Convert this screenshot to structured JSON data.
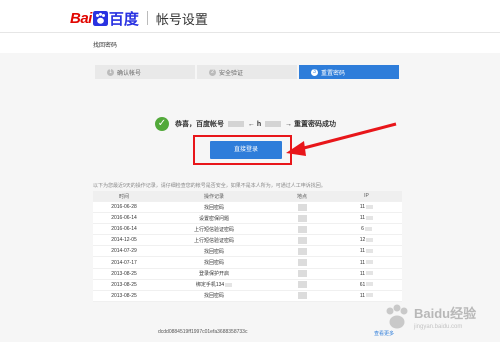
{
  "header": {
    "logo_bai": "Bai",
    "logo_du": "百度",
    "title": "帐号设置"
  },
  "subheader": {
    "title": "找回密码"
  },
  "steps": [
    {
      "num": "1",
      "label": "确认帐号",
      "active": false
    },
    {
      "num": "2",
      "label": "安全验证",
      "active": false
    },
    {
      "num": "3",
      "label": "重置密码",
      "active": true
    }
  ],
  "success": {
    "prefix": "恭喜，百度帐号",
    "arrow_text": "← h",
    "suffix": "→ 重置密码成功"
  },
  "login_button": "直接登录",
  "notice": "以下为您最近9天的操作记录，请仔细检查您的帐号是否安全，如果不是本人所为，可通过人工申诉找回。",
  "table": {
    "headers": [
      "时间",
      "操作记录",
      "地点",
      "IP"
    ],
    "rows": [
      {
        "date": "2016-06-28",
        "op": "找回密码",
        "ip": "11"
      },
      {
        "date": "2016-06-14",
        "op": "设置密保问题",
        "ip": "11"
      },
      {
        "date": "2016-06-14",
        "op": "上行短信验证密码",
        "ip": "6"
      },
      {
        "date": "2014-12-05",
        "op": "上行短信验证密码",
        "ip": "12"
      },
      {
        "date": "2014-07-29",
        "op": "找回密码",
        "ip": "11"
      },
      {
        "date": "2014-07-17",
        "op": "找回密码",
        "ip": "11"
      },
      {
        "date": "2013-08-25",
        "op": "登录保护开启",
        "ip": "11"
      },
      {
        "date": "2013-08-25",
        "op": "绑定手机134",
        "ip": "61"
      },
      {
        "date": "2013-08-25",
        "op": "找回密码",
        "ip": "11"
      }
    ]
  },
  "footer": {
    "hash": "dcdd0884519ff1997c01efa3688358733c",
    "more": "查看更多"
  },
  "watermark": {
    "title": "Baidu经验",
    "url": "jingyan.baidu.com"
  },
  "colors": {
    "brand_red": "#e10601",
    "brand_blue": "#2932e1",
    "accent": "#2e7dda",
    "success_green": "#52a93a",
    "annotation_red": "#e8161a"
  }
}
